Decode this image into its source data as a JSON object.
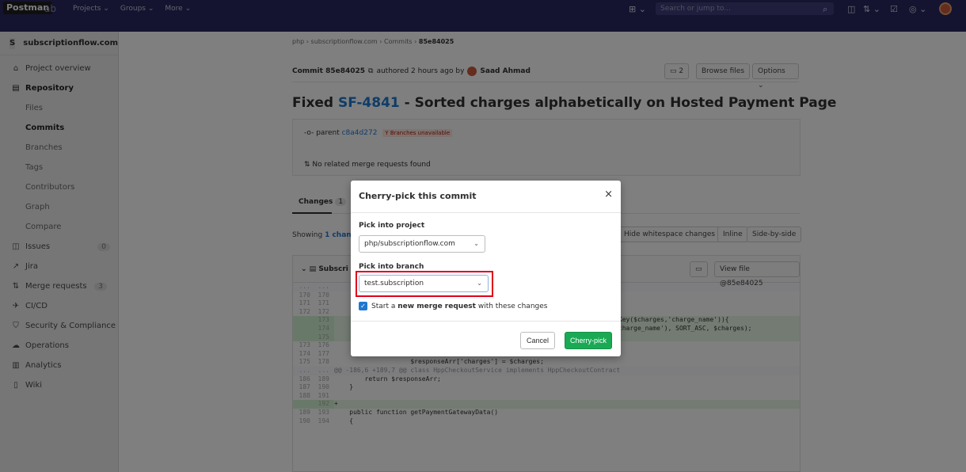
{
  "topbar": {
    "badge": "Postman",
    "badge_tail": "ab",
    "nav": [
      "Projects ⌄",
      "Groups ⌄",
      "More ⌄"
    ],
    "search_placeholder": "Search or jump to..."
  },
  "sidebar": {
    "project_initial": "S",
    "project_name": "subscriptionflow.com",
    "items": {
      "overview": "Project overview",
      "repository": "Repository",
      "files": "Files",
      "commits": "Commits",
      "branches": "Branches",
      "tags": "Tags",
      "contributors": "Contributors",
      "graph": "Graph",
      "compare": "Compare",
      "issues": "Issues",
      "issues_count": "0",
      "jira": "Jira",
      "merge_requests": "Merge requests",
      "mr_count": "3",
      "cicd": "CI/CD",
      "security": "Security & Compliance",
      "operations": "Operations",
      "analytics": "Analytics",
      "wiki": "Wiki"
    }
  },
  "breadcrumb": {
    "group": "php",
    "project": "subscriptionflow.com",
    "section": "Commits",
    "sha": "85e84025"
  },
  "commit": {
    "label": "Commit 85e84025",
    "authored": "authored 2 hours ago by",
    "author": "Saad Ahmad",
    "comments": "2",
    "browse_files": "Browse files",
    "options": "Options ⌄",
    "title_prefix": "Fixed",
    "title_link": "SF-4841",
    "title_rest": "- Sorted charges alphabetically on Hosted Payment Page",
    "parent_label": "parent",
    "parent_sha": "c8a4d272",
    "branches_warning": "Branches unavailable",
    "no_mr": "No related merge requests found"
  },
  "tabs": {
    "changes": "Changes",
    "changes_count": "1"
  },
  "diff_toolbar": {
    "showing": "Showing",
    "showing_link": "1 chang",
    "hide_ws": "Hide whitespace changes",
    "inline": "Inline",
    "side_by_side": "Side-by-side",
    "file_prefix": "Subscri",
    "view_file": "View file @85e84025",
    "contract_tail": "tContract"
  },
  "diff_lines": [
    {
      "a": "...",
      "b": "...",
      "text": "",
      "kind": "meta"
    },
    {
      "a": "170",
      "b": "170",
      "text": "",
      "kind": "ctx"
    },
    {
      "a": "171",
      "b": "171",
      "text": "",
      "kind": "ctx"
    },
    {
      "a": "172",
      "b": "172",
      "text": "",
      "kind": "ctx"
    },
    {
      "a": "",
      "b": "173",
      "text": "NestedKey($charges,'charge_name')){",
      "kind": "add"
    },
    {
      "a": "",
      "b": "174",
      "text": "ges, 'charge_name'), SORT_ASC, $charges);",
      "kind": "add"
    },
    {
      "a": "",
      "b": "175",
      "text": "",
      "kind": "add"
    },
    {
      "a": "173",
      "b": "176",
      "text": "                    }",
      "kind": "ctx"
    },
    {
      "a": "174",
      "b": "177",
      "text": "",
      "kind": "ctx"
    },
    {
      "a": "175",
      "b": "178",
      "text": "                    $responseArr['charges'] = $charges;",
      "kind": "ctx"
    },
    {
      "a": "...",
      "b": "...",
      "text": "@@ -186,6 +189,7 @@ class HppCheckoutService implements HppCheckoutContract",
      "kind": "meta"
    },
    {
      "a": "186",
      "b": "189",
      "text": "        return $responseArr;",
      "kind": "ctx"
    },
    {
      "a": "187",
      "b": "190",
      "text": "    }",
      "kind": "ctx"
    },
    {
      "a": "188",
      "b": "191",
      "text": "",
      "kind": "ctx"
    },
    {
      "a": "",
      "b": "192",
      "text": "+",
      "kind": "add"
    },
    {
      "a": "189",
      "b": "193",
      "text": "    public function getPaymentGatewayData()",
      "kind": "ctx"
    },
    {
      "a": "190",
      "b": "194",
      "text": "    {",
      "kind": "ctx"
    }
  ],
  "modal": {
    "title": "Cherry-pick this commit",
    "close": "×",
    "project_label": "Pick into project",
    "project_value": "php/subscriptionflow.com",
    "branch_label": "Pick into branch",
    "branch_value": "test.subscription",
    "checkbox_pre": "Start a",
    "checkbox_bold": "new merge request",
    "checkbox_post": "with these changes",
    "cancel": "Cancel",
    "cherry_pick": "Cherry-pick"
  },
  "colors": {
    "navbar": "#292961",
    "accent_blue": "#1f78d1",
    "success_green": "#1aaa55",
    "highlight_red": "#e0001b"
  }
}
